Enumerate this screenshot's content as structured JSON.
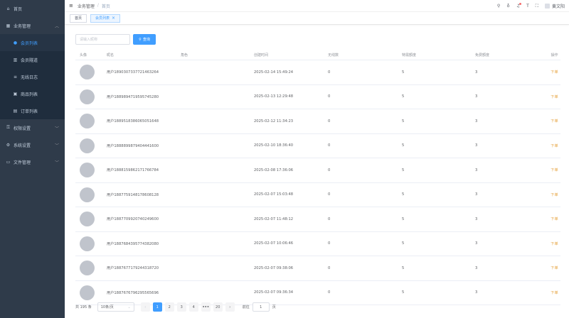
{
  "sidebar": {
    "home": "首页",
    "business": "业务管理",
    "sub_items": [
      "会员列表",
      "会员隧道",
      "无线日志",
      "商品列表",
      "订单列表"
    ],
    "permissions": "权限设置",
    "system": "系统设置",
    "files": "文件管理"
  },
  "header": {
    "breadcrumb_parent": "业务管理",
    "breadcrumb_sep": "/",
    "breadcrumb_current": "首页",
    "username": "黄文阳"
  },
  "tags": {
    "home": "首页",
    "current": "会员列表"
  },
  "search": {
    "placeholder": "请输入昵称",
    "button": "查询"
  },
  "table": {
    "headers": [
      "头像",
      "昵名",
      "角色",
      "创建时间",
      "无线数",
      "特需额度",
      "免费额度",
      "操作"
    ],
    "rows": [
      {
        "name": "用户1890307337721463264",
        "role": "",
        "time": "2025-02-14 15:49:24",
        "wuxian": "0",
        "teyue": "5",
        "mianfei": "3",
        "op": "下单"
      },
      {
        "name": "用户1889894719595745280",
        "role": "",
        "time": "2025-02-13 12:29:48",
        "wuxian": "0",
        "teyue": "5",
        "mianfei": "3",
        "op": "下单"
      },
      {
        "name": "用户1889518386065051648",
        "role": "",
        "time": "2025-02-12 11:34:23",
        "wuxian": "0",
        "teyue": "5",
        "mianfei": "3",
        "op": "下单"
      },
      {
        "name": "用户1888899879404441600",
        "role": "",
        "time": "2025-02-10 18:36:40",
        "wuxian": "0",
        "teyue": "5",
        "mianfei": "3",
        "op": "下单"
      },
      {
        "name": "用户1888159862171766784",
        "role": "",
        "time": "2025-02-08 17:36:06",
        "wuxian": "0",
        "teyue": "5",
        "mianfei": "3",
        "op": "下单"
      },
      {
        "name": "用户1887759148178608128",
        "role": "",
        "time": "2025-02-07 15:03:48",
        "wuxian": "0",
        "teyue": "5",
        "mianfei": "3",
        "op": "下单"
      },
      {
        "name": "用户1887709920740249600",
        "role": "",
        "time": "2025-02-07 11:48:12",
        "wuxian": "0",
        "teyue": "5",
        "mianfei": "3",
        "op": "下单"
      },
      {
        "name": "用户1887684395774382080",
        "role": "",
        "time": "2025-02-07 10:06:46",
        "wuxian": "0",
        "teyue": "5",
        "mianfei": "3",
        "op": "下单"
      },
      {
        "name": "用户1887677179244318720",
        "role": "",
        "time": "2025-02-07 09:38:06",
        "wuxian": "0",
        "teyue": "5",
        "mianfei": "3",
        "op": "下单"
      },
      {
        "name": "用户1887676796295565696",
        "role": "",
        "time": "2025-02-07 09:36:34",
        "wuxian": "0",
        "teyue": "5",
        "mianfei": "3",
        "op": "下单"
      }
    ]
  },
  "pagination": {
    "total": "共 195 条",
    "page_size": "10条/页",
    "prev": "‹",
    "next": "›",
    "pages": [
      "1",
      "2",
      "3",
      "4",
      "•••",
      "20"
    ],
    "active_page": "1",
    "goto_label": "前往",
    "goto_value": "1",
    "page_unit": "页"
  },
  "colors": {
    "sidebar_bg": "#2f3b4a",
    "accent": "#409eff",
    "link_warning": "#e6a23c"
  },
  "icons": {
    "home": "home-icon",
    "business": "grid-icon",
    "members": "user-icon",
    "tunnel": "chart-icon",
    "log": "list-icon",
    "goods": "box-icon",
    "orders": "document-icon",
    "permissions": "lock-icon",
    "system": "gear-icon",
    "files": "folder-icon"
  }
}
